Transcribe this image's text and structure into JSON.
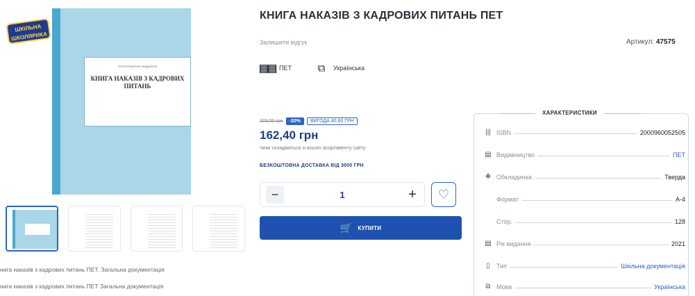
{
  "product": {
    "title": "КНИГА НАКАЗІВ З КАДРОВИХ ПИТАНЬ ПЕТ",
    "review_link": "Залишити відгук",
    "sku_label": "Артикул:",
    "sku_value": "47575",
    "publisher": "ПЕТ",
    "language": "Українська"
  },
  "cover": {
    "badge": "ШКІЛЬНА ШКОЛЯРИКА",
    "small_text": "ПОЛІГРАФІЧНЕ ВИДАННЯ",
    "title": "КНИГА НАКАЗІВ З КАДРОВИХ ПИТАНЬ"
  },
  "gallery": {
    "captions": [
      "нига наказів з кадрових питань ПЕТ. Загальна документація",
      "нига наказів з кадрових питань ПЕТ Загальна документація"
    ]
  },
  "pricing": {
    "old_price": "203,00 грн",
    "discount": "-20%",
    "benefit": "ВИГОДА 40,60 ГРН",
    "price": "162,40 грн",
    "note": "Чеки складаються зі всього асортименту сайту",
    "free_shipping": "БЕЗКОШТОВНА ДОСТАВКА ВІД 3000 ГРН"
  },
  "cart": {
    "quantity": "1",
    "buy_label": "КУПИТИ"
  },
  "characteristics": {
    "title": "ХАРАКТЕРИСТИКИ",
    "rows": [
      {
        "label": "ISBN",
        "value": "2000960052505",
        "icon": "barcode-icon",
        "link": false
      },
      {
        "label": "Видавництво",
        "value": "ПЕТ",
        "icon": "publisher-icon",
        "link": true
      },
      {
        "label": "Обкладинка",
        "value": "Тверда",
        "icon": "cover-icon",
        "link": false
      },
      {
        "label": "Формат",
        "value": "А-4",
        "icon": "",
        "link": false
      },
      {
        "label": "Стор.",
        "value": "128",
        "icon": "",
        "link": false
      },
      {
        "label": "Рік видання",
        "value": "2021",
        "icon": "calendar-icon",
        "link": false
      },
      {
        "label": "Тип",
        "value": "Шкільна документація",
        "icon": "document-icon",
        "link": true
      },
      {
        "label": "Мова",
        "value": "Українська",
        "icon": "language-icon",
        "link": true
      }
    ]
  }
}
